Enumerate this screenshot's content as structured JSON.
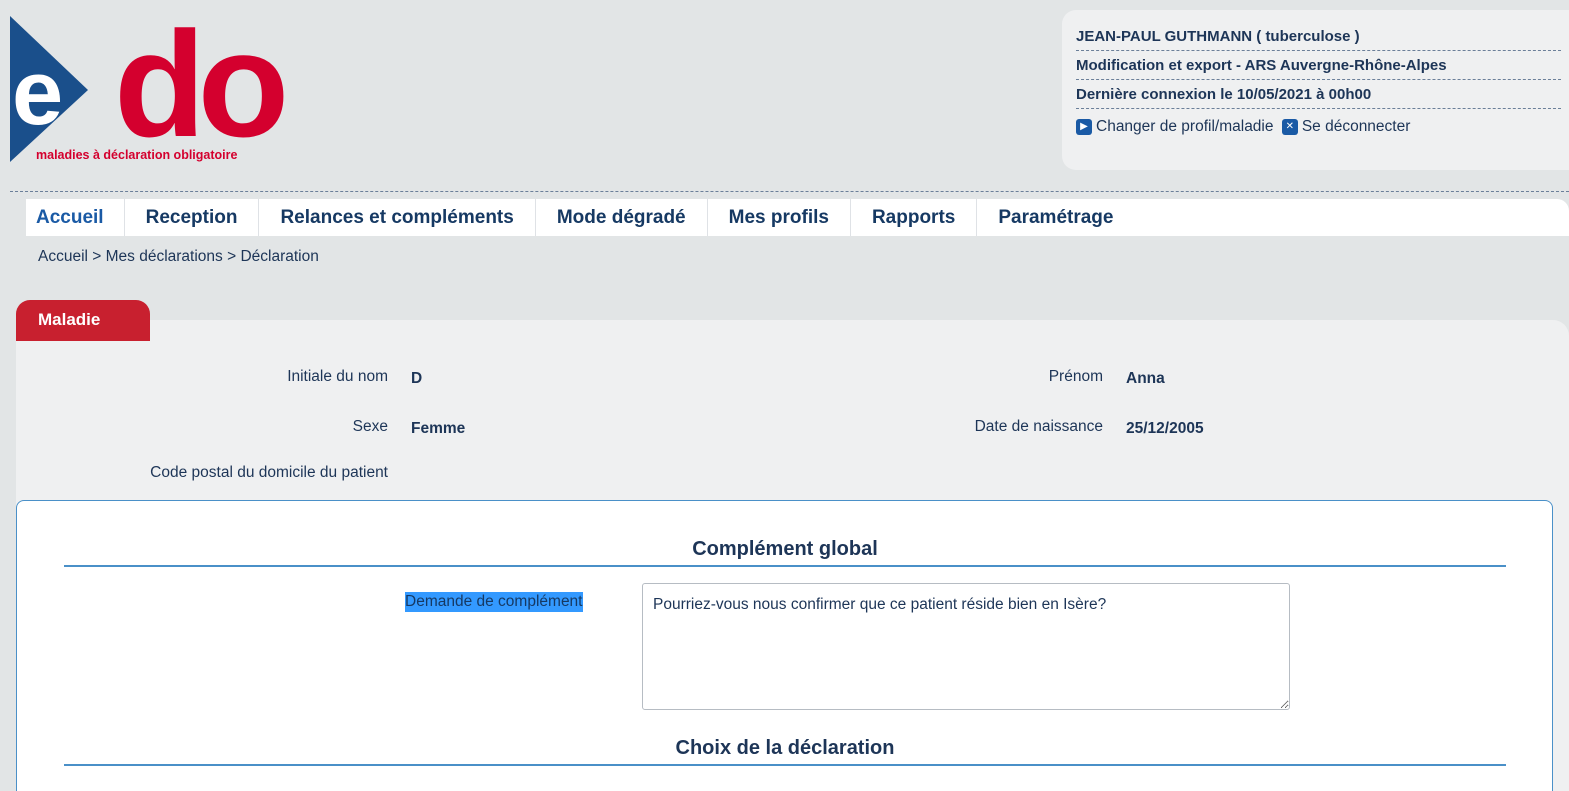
{
  "logo": {
    "text_e": "e",
    "text_do": "do",
    "tagline": "maladies à déclaration obligatoire"
  },
  "user": {
    "name": "JEAN-PAUL GUTHMANN ( tuberculose )",
    "role": "Modification et export - ARS Auvergne-Rhône-Alpes",
    "last_login": "Dernière connexion le 10/05/2021 à 00h00",
    "change_profile": "Changer de profil/maladie",
    "logout": "Se déconnecter"
  },
  "nav": {
    "items": [
      "Accueil",
      "Reception",
      "Relances et compléments",
      "Mode dégradé",
      "Mes profils",
      "Rapports",
      "Paramétrage"
    ]
  },
  "breadcrumb": "Accueil > Mes déclarations > Déclaration",
  "maladie_tab": "Maladie",
  "patient": {
    "initial_label": "Initiale du nom",
    "initial_value": "D",
    "prenom_label": "Prénom",
    "prenom_value": "Anna",
    "sexe_label": "Sexe",
    "sexe_value": "Femme",
    "dob_label": "Date de naissance",
    "dob_value": "25/12/2005",
    "postal_label": "Code postal du domicile du patient"
  },
  "complement": {
    "title": "Complément global",
    "request_label": "Demande de complément",
    "request_text": "Pourriez-vous nous confirmer que ce patient réside bien en Isère?"
  },
  "choix": {
    "title": "Choix de la déclaration"
  },
  "colors": {
    "brand_red": "#d4002e",
    "brand_blue": "#1a4f8b",
    "nav_text": "#163963",
    "accent_line": "#4a90c8"
  }
}
